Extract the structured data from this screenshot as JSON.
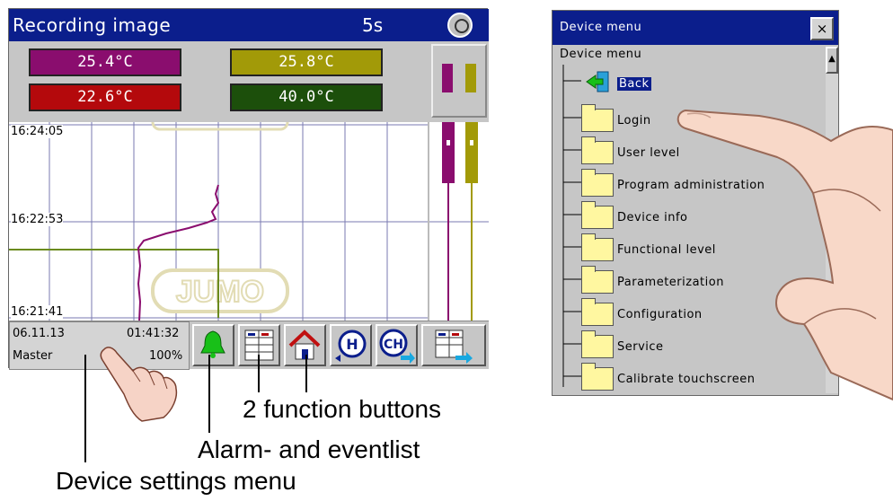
{
  "recorder": {
    "title": "Recording image",
    "interval": "5s",
    "values": [
      "25.4°C",
      "25.8°C",
      "22.6°C",
      "40.0°C"
    ],
    "time_labels": [
      "16:24:05",
      "16:22:53",
      "16:21:41"
    ],
    "watermark": "JUMO",
    "date": "06.11.13",
    "time": "01:41:32",
    "user": "Master",
    "memory": "100%",
    "colors": {
      "purple": "#8a0d6e",
      "olive": "#a29a08",
      "red": "#b4090c",
      "green": "#1c4f0b",
      "title_bar": "#0b1e8c"
    }
  },
  "buttons": [
    {
      "name": "alarm-button",
      "icon": "bell-icon"
    },
    {
      "name": "display-button",
      "icon": "grid-display-icon"
    },
    {
      "name": "home-button",
      "icon": "home-icon"
    },
    {
      "name": "history-button",
      "icon": "history-icon",
      "label": "H"
    },
    {
      "name": "channel-button",
      "icon": "channel-icon",
      "label": "CH"
    },
    {
      "name": "next-display-button",
      "icon": "grid-arrow-icon"
    }
  ],
  "device_menu": {
    "title": "Device menu",
    "close": "×",
    "heading": "Device menu",
    "scroll_up": "▲",
    "back": "Back",
    "items": [
      "Login",
      "User level",
      "Program administration",
      "Device info",
      "Functional level",
      "Parameterization",
      "Configuration",
      "Service",
      "Calibrate touchscreen"
    ]
  },
  "captions": {
    "function_buttons": "2 function buttons",
    "alarm_list": "Alarm- and eventlist",
    "device_settings": "Device settings menu"
  }
}
